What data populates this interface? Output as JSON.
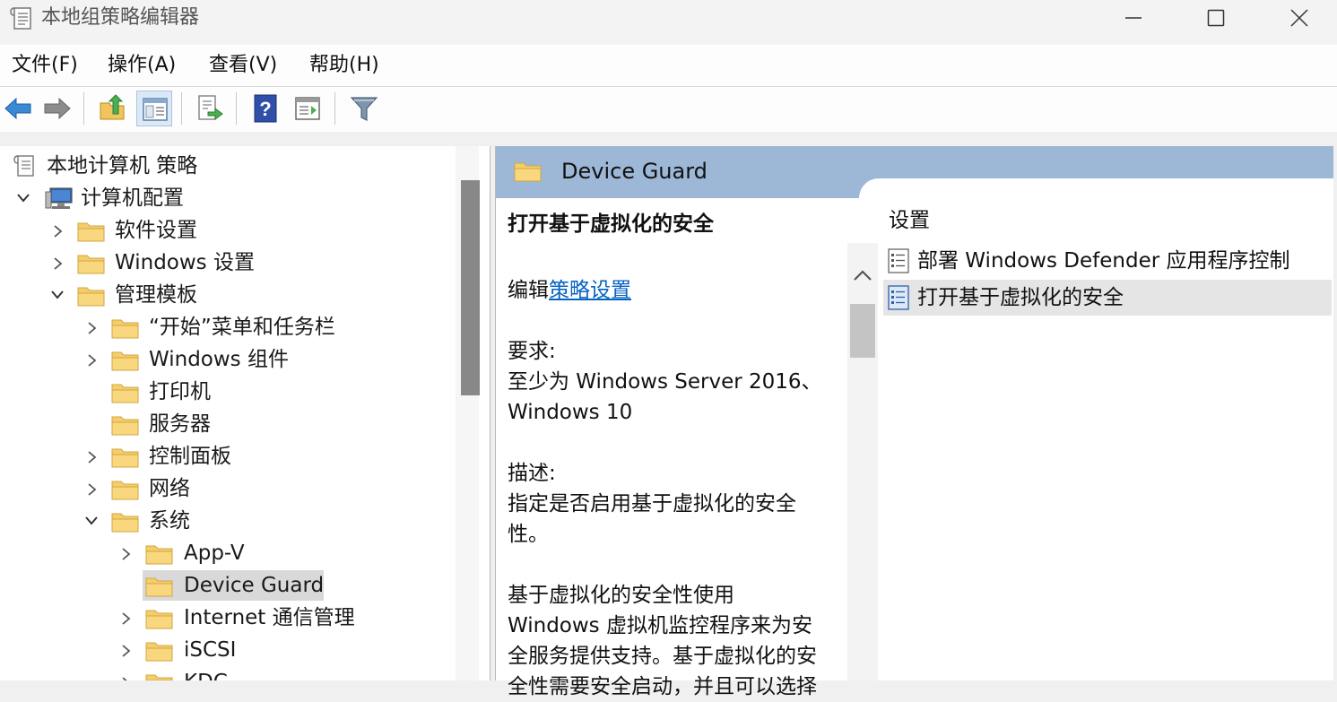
{
  "window": {
    "title": "本地组策略编辑器",
    "icon": "policy-document-icon",
    "controls": [
      "minimize-icon",
      "maximize-icon",
      "close-icon"
    ]
  },
  "menubar": {
    "items": [
      "文件(F)",
      "操作(A)",
      "查看(V)",
      "帮助(H)"
    ]
  },
  "toolbar": {
    "buttons": [
      "back-arrow-icon",
      "forward-arrow-icon",
      "up-folder-icon",
      "show-hide-tree-icon",
      "export-list-icon",
      "help-icon",
      "show-action-pane-icon",
      "filter-icon"
    ],
    "active": "show-hide-tree-icon"
  },
  "tree": {
    "root": "本地计算机 策略",
    "computer_config": "计算机配置",
    "software_settings": "软件设置",
    "windows_settings": "Windows 设置",
    "admin_templates": "管理模板",
    "start_menu": "“开始”菜单和任务栏",
    "windows_components": "Windows 组件",
    "printers": "打印机",
    "server": "服务器",
    "control_panel": "控制面板",
    "network": "网络",
    "system": "系统",
    "appv": "App-V",
    "device_guard": "Device Guard",
    "internet_comm": "Internet 通信管理",
    "iscsi": "iSCSI",
    "kdc": "KDC",
    "selected": "Device Guard"
  },
  "details": {
    "header_title": "Device Guard",
    "policy_title": "打开基于虚拟化的安全",
    "edit_prefix": "编辑",
    "edit_link": "策略设置",
    "requirements_label": "要求:",
    "requirements_text_1": "至少为 Windows Server 2016、",
    "requirements_text_2": "Windows 10",
    "description_label": "描述:",
    "description_1": "指定是否启用基于虚拟化的安全",
    "description_2": "性。",
    "description_3": "基于虚拟化的安全性使用",
    "description_4": "Windows 虚拟机监控程序来为安",
    "description_5": "全服务提供支持。基于虚拟化的安",
    "description_6": "全性需要安全启动，并且可以选择"
  },
  "settings": {
    "column_header": "设置",
    "items": [
      {
        "label": "部署 Windows Defender 应用程序控制",
        "icon": "policy-setting-icon",
        "selected": false
      },
      {
        "label": "打开基于虚拟化的安全",
        "icon": "policy-setting-icon",
        "selected": true
      }
    ]
  },
  "colors": {
    "header_blue": "#9db7d6",
    "link": "#0563c1",
    "selection": "#d9d9d9",
    "folder": "#f5cd6b"
  }
}
